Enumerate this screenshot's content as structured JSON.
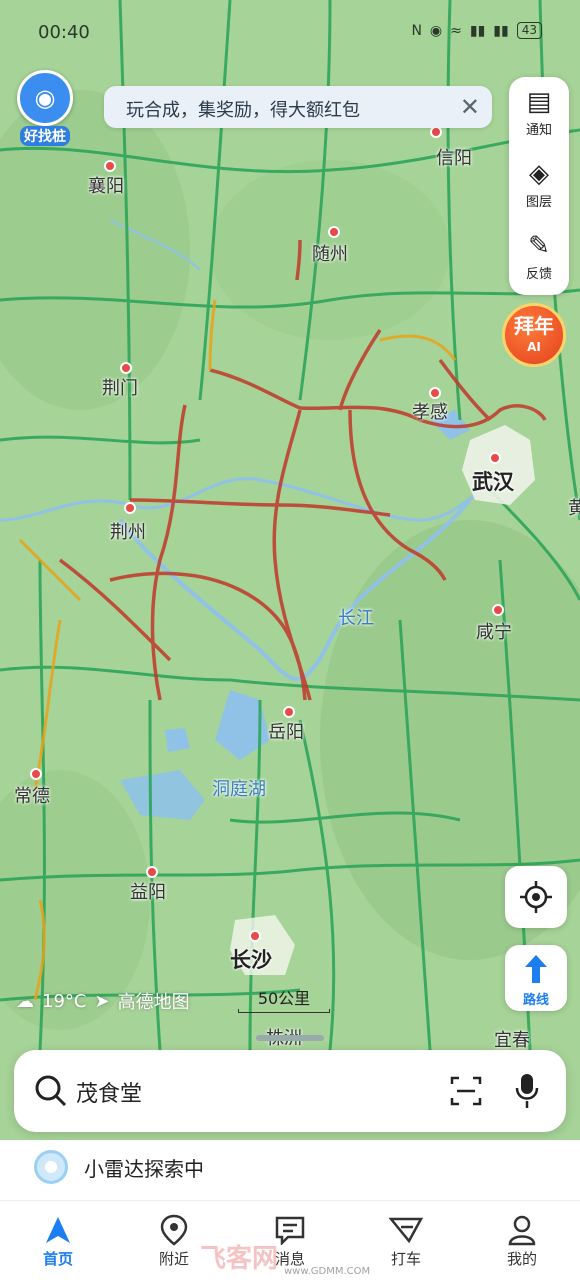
{
  "status_bar": {
    "time": "00:40",
    "battery": "43",
    "icons": [
      "nfc-icon",
      "location-icon",
      "wifi-icon",
      "signal-5g-icon",
      "signal-4g-icon"
    ]
  },
  "promo_banner": {
    "text": "玩合成，集奖励，得大额红包"
  },
  "find_pile": {
    "label": "好找桩"
  },
  "right_panel": {
    "notify_label": "通知",
    "layers_label": "图层",
    "feedback_label": "反馈"
  },
  "ai_badge": {
    "top": "拜年",
    "bottom": "AI"
  },
  "map": {
    "cities": {
      "xiangyang": "襄阳",
      "xinyang": "信阳",
      "suizhou": "随州",
      "jingmen": "荆门",
      "xiaogan": "孝感",
      "wuhan": "武汉",
      "jingzhou": "荆州",
      "changjiang": "长江",
      "xianning": "咸宁",
      "yueyang": "岳阳",
      "dongtinghu": "洞庭湖",
      "changde": "常德",
      "yiyang": "益阳",
      "changsha": "长沙",
      "zhuzhou": "株洲",
      "yichun": "宜春",
      "huang": "黄"
    },
    "weather": "19°C",
    "brand": "高德地图",
    "scale": "50公里"
  },
  "route_button": {
    "label": "路线"
  },
  "search": {
    "value": "茂食堂"
  },
  "radar": {
    "text": "小雷达探索中"
  },
  "nav": [
    {
      "label": "首页",
      "icon": "navigate-arrow-icon",
      "active": true
    },
    {
      "label": "附近",
      "icon": "location-pin-icon",
      "active": false
    },
    {
      "label": "消息",
      "icon": "message-icon",
      "active": false
    },
    {
      "label": "打车",
      "icon": "taxi-icon",
      "active": false
    },
    {
      "label": "我的",
      "icon": "person-icon",
      "active": false
    }
  ],
  "watermark": {
    "text": "飞客网",
    "url": "www.GDMM.COM"
  },
  "colors": {
    "accent": "#1d7ef0",
    "road_green": "#2fa55a",
    "congestion_red": "#c0392b",
    "map_bg": "#a8d49b"
  }
}
